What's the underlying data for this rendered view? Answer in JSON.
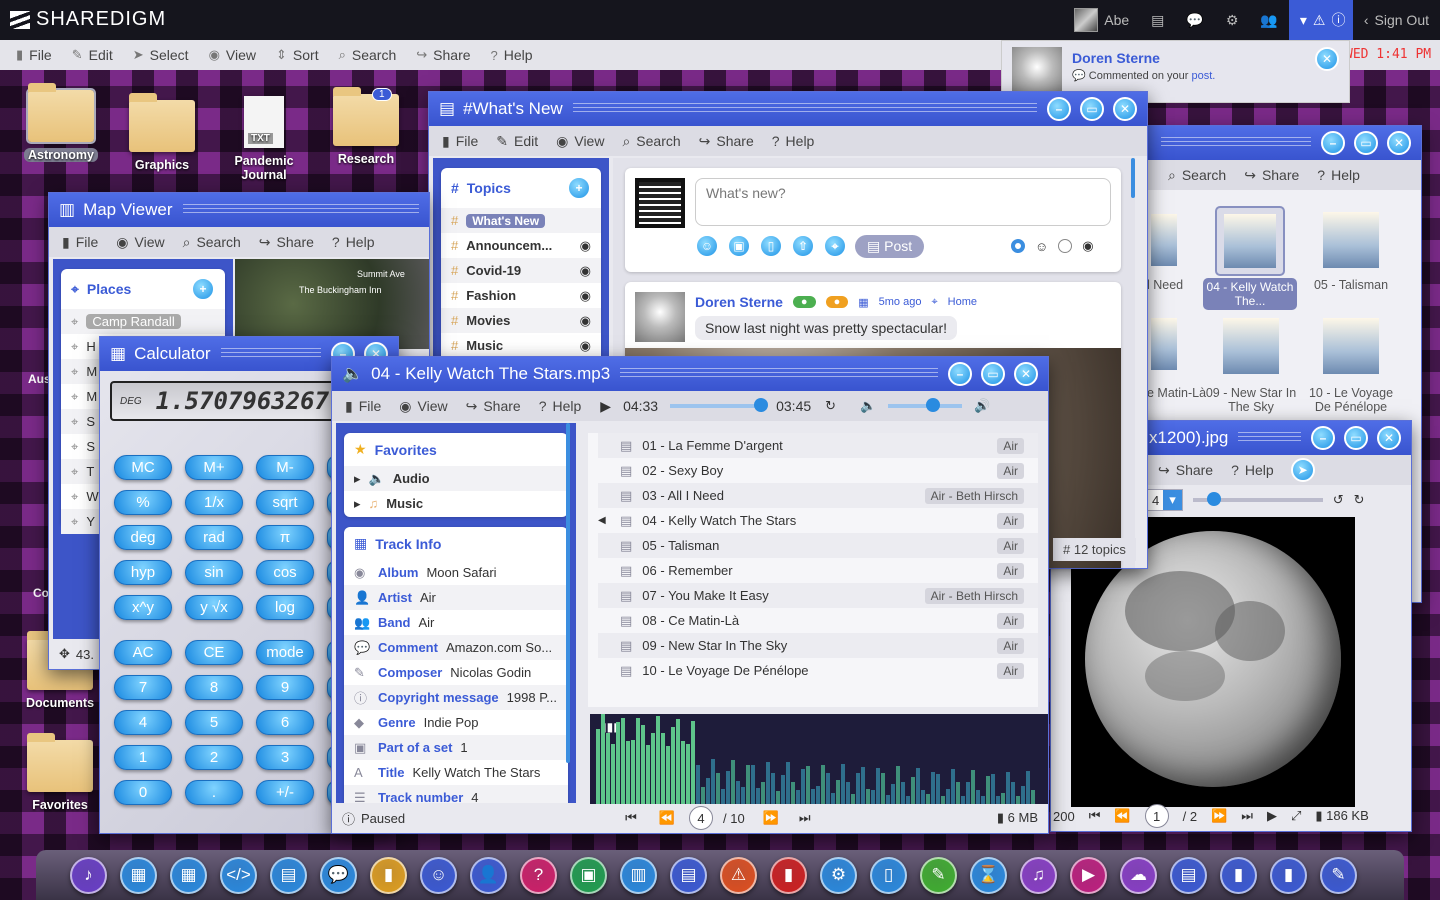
{
  "topbar": {
    "brand": "SHAREDIGM",
    "user": "Abe",
    "sign_out": "Sign Out",
    "clock": "WED 1:41 PM"
  },
  "menubar": {
    "items": [
      "File",
      "Edit",
      "Select",
      "View",
      "Sort",
      "Search",
      "Share",
      "Help"
    ]
  },
  "notification": {
    "name": "Doren Sterne",
    "text": "Commented on your",
    "link": "post."
  },
  "desktop_icons": [
    "Astronomy",
    "Graphics",
    "Pandemic Journal",
    "Research",
    "Documents",
    "Favorites"
  ],
  "desktop_partial": [
    "A",
    "Aus",
    "C",
    "Co"
  ],
  "research_badge": "1",
  "whatsnew": {
    "title": "#What's New",
    "menu": [
      "File",
      "Edit",
      "View",
      "Search",
      "Share",
      "Help"
    ],
    "topics_header": "Topics",
    "topics": [
      "What's New",
      "Announcem...",
      "Covid-19",
      "Fashion",
      "Movies",
      "Music"
    ],
    "topic_count": "12 topics",
    "placeholder": "What's new?",
    "post_button": "Post",
    "post_author": "Doren Sterne",
    "post_time": "5mo ago",
    "post_location": "Home",
    "post_text": "Snow last night was pretty spectacular!"
  },
  "mapviewer": {
    "title": "Map Viewer",
    "menu": [
      "File",
      "View",
      "Search",
      "Share",
      "Help"
    ],
    "places_header": "Places",
    "places": [
      "Camp Randall",
      "H",
      "M",
      "M",
      "S",
      "S",
      "T",
      "W",
      "Y"
    ],
    "map_labels": [
      "The Buckingham Inn",
      "Summit Ave"
    ],
    "status": "43."
  },
  "calculator": {
    "title": "Calculator",
    "mode": "DEG",
    "display": "1.5707963267",
    "rows": [
      [
        "MC",
        "M+",
        "M-"
      ],
      [
        "%",
        "1/x",
        "sqrt"
      ],
      [
        "deg",
        "rad",
        "π"
      ],
      [
        "hyp",
        "sin",
        "cos"
      ],
      [
        "x^y",
        "y √x",
        "log"
      ],
      [
        "AC",
        "CE",
        "mode"
      ],
      [
        "7",
        "8",
        "9"
      ],
      [
        "4",
        "5",
        "6"
      ],
      [
        "1",
        "2",
        "3"
      ],
      [
        "0",
        ".",
        "+/-"
      ]
    ]
  },
  "player": {
    "title": "04 - Kelly Watch The Stars.mp3",
    "menu": [
      "File",
      "View",
      "Share",
      "Help"
    ],
    "elapsed": "04:33",
    "duration": "03:45",
    "progress": 0.97,
    "volume": 0.6,
    "favorites_header": "Favorites",
    "favorites": [
      "Audio",
      "Music"
    ],
    "info_header": "Track Info",
    "info": [
      {
        "k": "Album",
        "v": "Moon Safari"
      },
      {
        "k": "Artist",
        "v": "Air"
      },
      {
        "k": "Band",
        "v": "Air"
      },
      {
        "k": "Comment",
        "v": "Amazon.com So..."
      },
      {
        "k": "Composer",
        "v": "Nicolas Godin"
      },
      {
        "k": "Copyright message",
        "v": "1998 P..."
      },
      {
        "k": "Genre",
        "v": "Indie Pop"
      },
      {
        "k": "Part of a set",
        "v": "1"
      },
      {
        "k": "Title",
        "v": "Kelly Watch The Stars"
      },
      {
        "k": "Track number",
        "v": "4"
      }
    ],
    "tracks": [
      {
        "name": "01 - La Femme D'argent",
        "tag": "Air"
      },
      {
        "name": "02 - Sexy Boy",
        "tag": "Air"
      },
      {
        "name": "03 - All I Need",
        "tag": "Air - Beth Hirsch"
      },
      {
        "name": "04 - Kelly Watch The Stars",
        "tag": "Air"
      },
      {
        "name": "05 - Talisman",
        "tag": "Air"
      },
      {
        "name": "06 - Remember",
        "tag": "Air"
      },
      {
        "name": "07 - You Make It Easy",
        "tag": "Air - Beth Hirsch"
      },
      {
        "name": "08 - Ce Matin-Là",
        "tag": "Air"
      },
      {
        "name": "09 - New Star In The Sky",
        "tag": "Air"
      },
      {
        "name": "10 - Le Voyage De Pénélope",
        "tag": "Air"
      }
    ],
    "status": "Paused",
    "page": "4",
    "page_total": "/ 10",
    "size": "6 MB"
  },
  "musicfolder": {
    "menu": [
      "Search",
      "Share",
      "Help"
    ],
    "items": [
      "l Need",
      "04 - Kelly Watch The...",
      "05 - Talisman",
      "e Matin-Là",
      "09 - New Star In The Sky",
      "10 - Le Voyage De Pénélope"
    ]
  },
  "imageviewer": {
    "title": "x1200).jpg",
    "menu": [
      "Share",
      "Help"
    ],
    "zoom_value": "4",
    "left_num": "200",
    "page": "1",
    "page_total": "/ 2",
    "size": "186 KB"
  },
  "colors": {
    "accent": "#3b5bd6",
    "titlebar": "#4663e0",
    "button": "#1e93e6",
    "dock": "#4b4258"
  }
}
